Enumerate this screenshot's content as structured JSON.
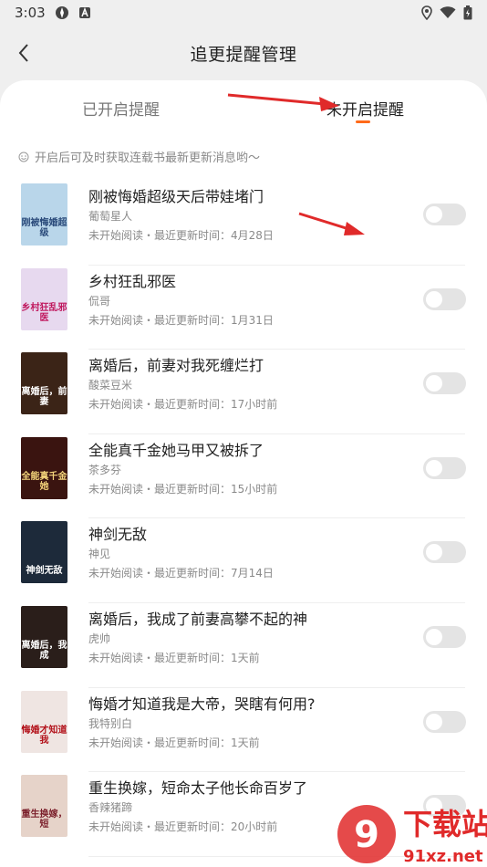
{
  "status_bar": {
    "time": "3:03"
  },
  "header": {
    "title": "追更提醒管理"
  },
  "tabs": [
    {
      "label": "已开启提醒",
      "active": false
    },
    {
      "label": "未开启提醒",
      "active": true
    }
  ],
  "hint": {
    "text": "开启后可及时获取连载书最新更新消息哟～"
  },
  "books": [
    {
      "title": "刚被悔婚超级天后带娃堵门",
      "author": "葡萄星人",
      "meta": "未开始阅读・最近更新时间：4月28日",
      "cover_bg": "#b9d6ea",
      "cover_fg": "#2a4a7a",
      "enabled": false
    },
    {
      "title": "乡村狂乱邪医",
      "author": "侃哥",
      "meta": "未开始阅读・最近更新时间：1月31日",
      "cover_bg": "#e7d9ef",
      "cover_fg": "#c0175d",
      "enabled": false
    },
    {
      "title": "离婚后，前妻对我死缠烂打",
      "author": "酸菜豆米",
      "meta": "未开始阅读・最近更新时间：17小时前",
      "cover_bg": "#3b2417",
      "cover_fg": "#ffffff",
      "enabled": false
    },
    {
      "title": "全能真千金她马甲又被拆了",
      "author": "茶多芬",
      "meta": "未开始阅读・最近更新时间：15小时前",
      "cover_bg": "#3a1410",
      "cover_fg": "#f3d37a",
      "enabled": false
    },
    {
      "title": "神剑无敌",
      "author": "神见",
      "meta": "未开始阅读・最近更新时间：7月14日",
      "cover_bg": "#1d2a3a",
      "cover_fg": "#ffffff",
      "enabled": false
    },
    {
      "title": "离婚后，我成了前妻高攀不起的神",
      "author": "虎帅",
      "meta": "未开始阅读・最近更新时间：1天前",
      "cover_bg": "#2a1e1a",
      "cover_fg": "#ffffff",
      "enabled": false
    },
    {
      "title": "悔婚才知道我是大帝，哭瞎有何用?",
      "author": "我特别白",
      "meta": "未开始阅读・最近更新时间：1天前",
      "cover_bg": "#efe5e2",
      "cover_fg": "#b3121b",
      "enabled": false
    },
    {
      "title": "重生换嫁，短命太子他长命百岁了",
      "author": "香辣猪蹄",
      "meta": "未开始阅读・最近更新时间：20小时前",
      "cover_bg": "#e6d3c9",
      "cover_fg": "#7a1e2a",
      "enabled": false
    }
  ],
  "watermark": {
    "brand": "下载站",
    "site": "91xz.net",
    "logo": "9"
  },
  "colors": {
    "accent": "#ff6a1a",
    "arrow": "#e02a2a"
  }
}
